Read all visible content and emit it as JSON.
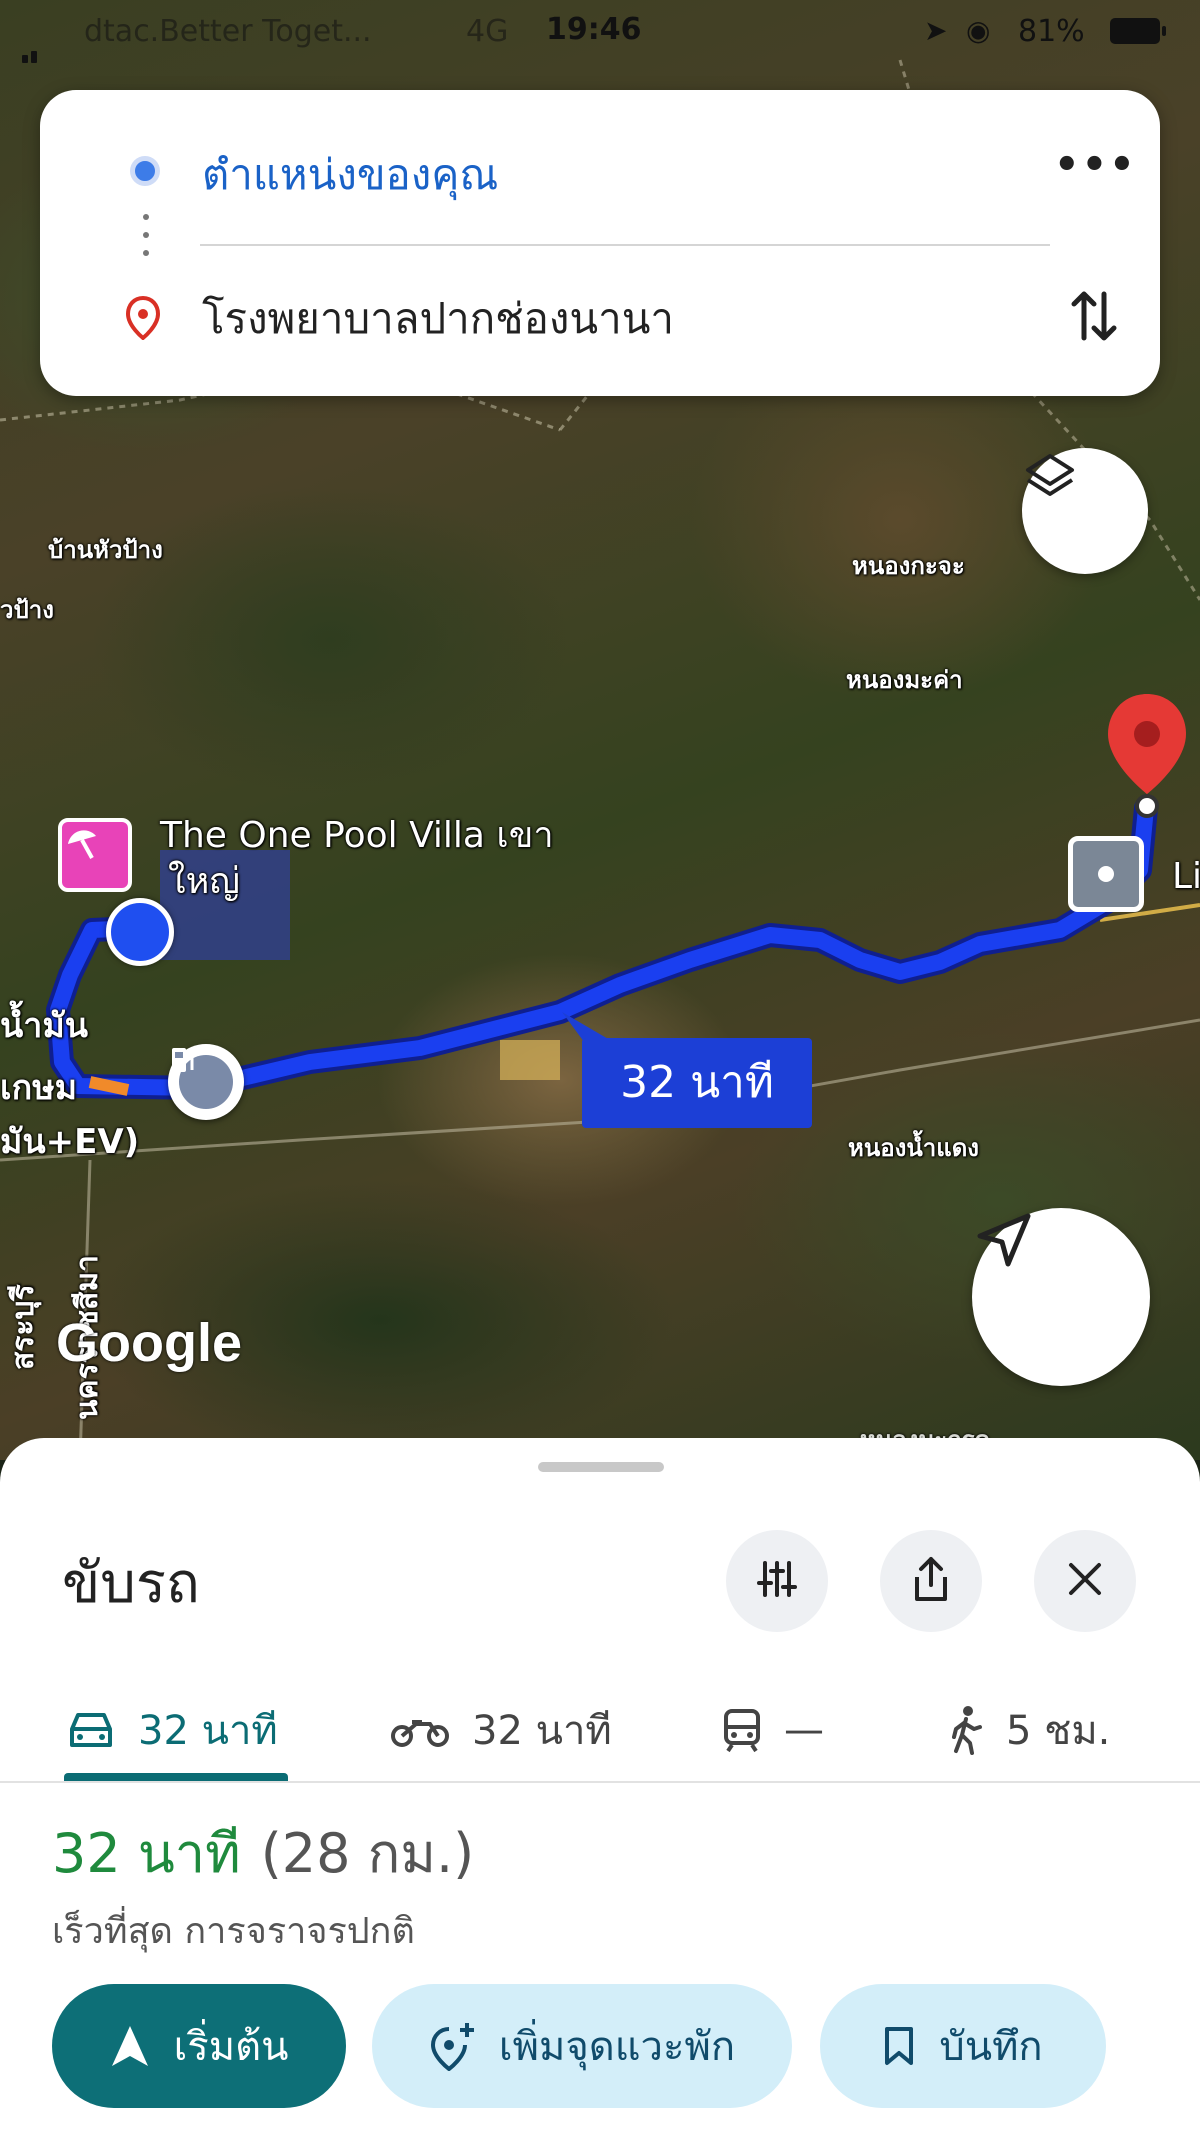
{
  "status_bar": {
    "carrier": "dtac.Better Toget...",
    "network": "4G",
    "time": "19:46",
    "battery": "81%"
  },
  "search": {
    "origin": "ตำแหน่งของคุณ",
    "destination": "โรงพยาบาลปากช่องนานา"
  },
  "map": {
    "labels": {
      "ban_hua_pang": "บ้านหัวป้าง",
      "hua_pang_partial": "วป้าง",
      "nong_kra_ja": "หนองกะจะ",
      "nong_ma_kham": "หนองมะค่า",
      "nong_nam_daeng": "หนองน้ำแดง",
      "nong_bottom": "หนองมะกรูด",
      "saraburi": "สระบุรี",
      "nakhon_ratchasima": "นครราชสีมา",
      "gas_line1": "น้ำมัน",
      "gas_line2": "เกษม",
      "gas_line3": "มัน+EV)",
      "poi_name_line1": "The One Pool Villa เขา",
      "poi_name_line2": "ใหญ่",
      "dest_partial": "Li"
    },
    "eta_label": "32 นาที",
    "logo": "Google"
  },
  "sheet": {
    "mode_title": "ขับรถ",
    "tabs": {
      "drive": "32 นาที",
      "motorcycle": "32 นาที",
      "transit": "—",
      "walk": "5 ชม."
    },
    "duration": "32 นาที",
    "distance": "(28 กม.)",
    "route_description": "เร็วที่สุด การจราจรปกติ",
    "actions": {
      "start": "เริ่มต้น",
      "add_stop": "เพิ่มจุดแวะพัก",
      "save": "บันทึก"
    }
  },
  "colors": {
    "route": "#1a3ff0",
    "accent_teal": "#0d6f77",
    "duration_green": "#1f8a3d",
    "origin_blue": "#1a62c7"
  }
}
